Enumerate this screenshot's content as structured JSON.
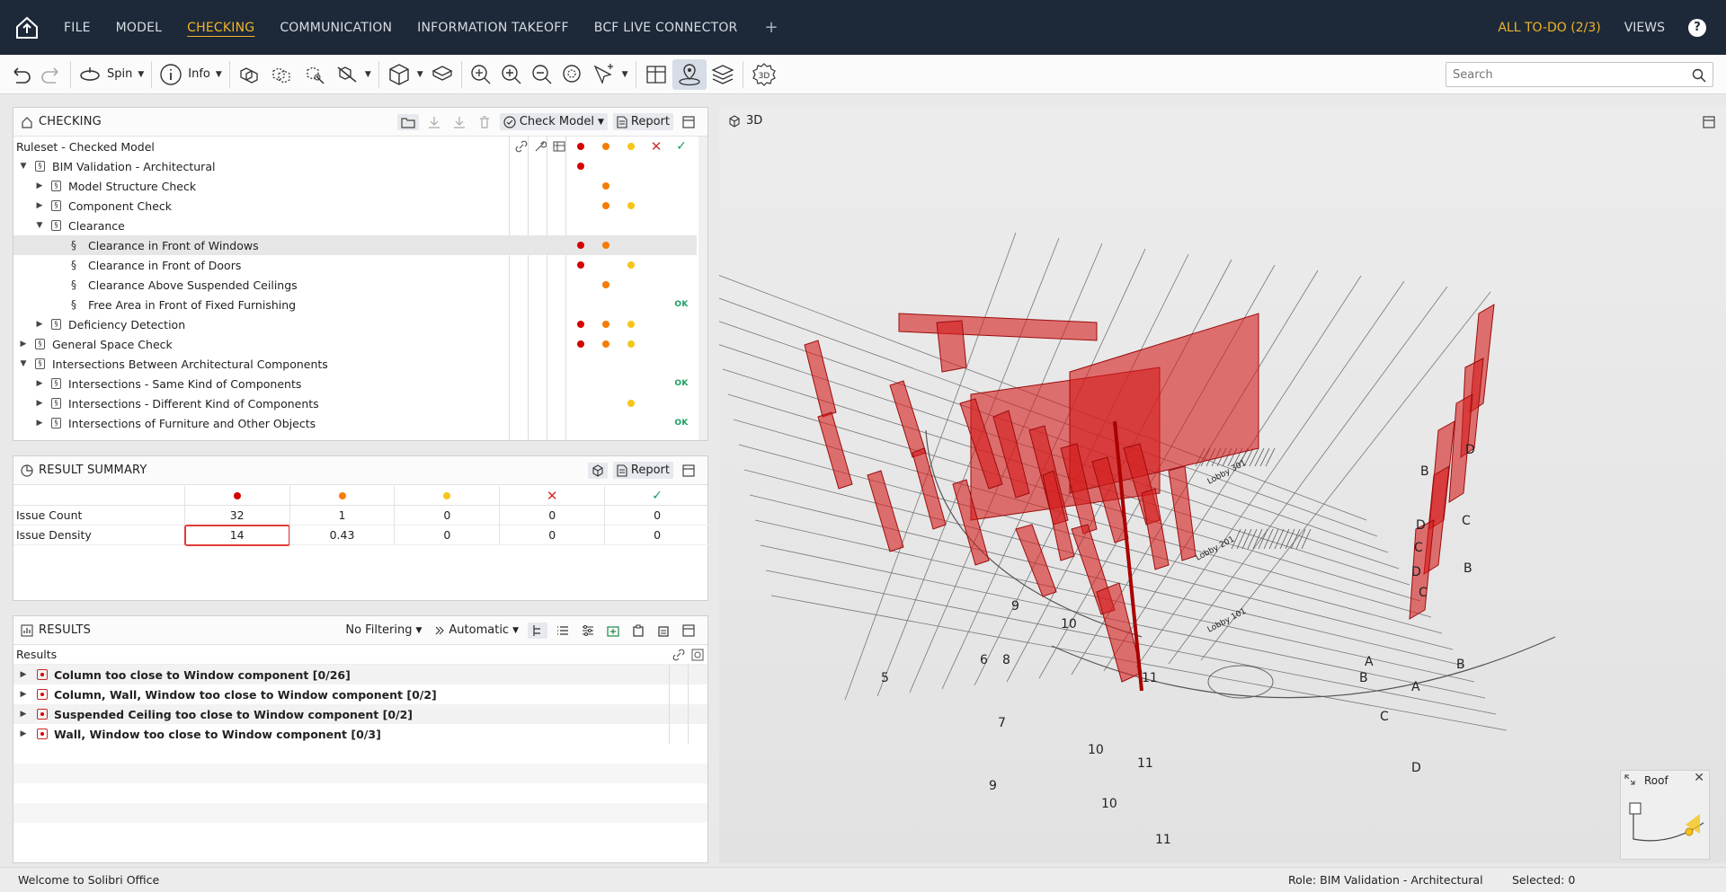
{
  "nav": {
    "menus": [
      "FILE",
      "MODEL",
      "CHECKING",
      "COMMUNICATION",
      "INFORMATION TAKEOFF",
      "BCF LIVE CONNECTOR"
    ],
    "plus": "+",
    "todo": "ALL TO-DO (2/3)",
    "views": "VIEWS",
    "help": "?"
  },
  "toolbar": {
    "spin": "Spin",
    "info": "Info",
    "three_d": "3D"
  },
  "search": {
    "placeholder": "Search"
  },
  "checking": {
    "title": "CHECKING",
    "check_model": "Check Model",
    "report": "Report",
    "ruleset_header": "Ruleset - Checked Model",
    "rows": [
      {
        "label": "BIM Validation - Architectural",
        "level": 0,
        "expander": "open",
        "icon": "ruleset",
        "red": true,
        "orange": false,
        "yellow": false,
        "ok": false
      },
      {
        "label": "Model Structure Check",
        "level": 1,
        "expander": "closed",
        "icon": "ruleset",
        "red": false,
        "orange": true,
        "yellow": false,
        "ok": false
      },
      {
        "label": "Component Check",
        "level": 1,
        "expander": "closed",
        "icon": "ruleset",
        "red": false,
        "orange": true,
        "yellow": true,
        "ok": false
      },
      {
        "label": "Clearance",
        "level": 1,
        "expander": "open",
        "icon": "ruleset",
        "red": false,
        "orange": false,
        "yellow": false,
        "ok": false
      },
      {
        "label": "Clearance in Front of Windows",
        "level": 2,
        "expander": "none",
        "icon": "rule",
        "red": true,
        "orange": true,
        "yellow": false,
        "ok": false,
        "selected": true
      },
      {
        "label": "Clearance in Front of Doors",
        "level": 2,
        "expander": "none",
        "icon": "rule",
        "red": true,
        "orange": false,
        "yellow": true,
        "ok": false
      },
      {
        "label": "Clearance Above Suspended Ceilings",
        "level": 2,
        "expander": "none",
        "icon": "rule",
        "red": false,
        "orange": true,
        "yellow": false,
        "ok": false
      },
      {
        "label": "Free Area in Front of Fixed Furnishing",
        "level": 2,
        "expander": "none",
        "icon": "rule",
        "red": false,
        "orange": false,
        "yellow": false,
        "ok": true
      },
      {
        "label": "Deficiency Detection",
        "level": 1,
        "expander": "closed",
        "icon": "ruleset",
        "red": true,
        "orange": true,
        "yellow": true,
        "ok": false
      },
      {
        "label": "General Space Check",
        "level": 0,
        "expander": "closed",
        "icon": "ruleset",
        "red": true,
        "orange": true,
        "yellow": true,
        "ok": false
      },
      {
        "label": "Intersections Between Architectural Components",
        "level": 0,
        "expander": "open",
        "icon": "ruleset",
        "red": false,
        "orange": false,
        "yellow": false,
        "ok": false
      },
      {
        "label": "Intersections - Same Kind of Components",
        "level": 1,
        "expander": "closed",
        "icon": "ruleset",
        "red": false,
        "orange": false,
        "yellow": false,
        "ok": true
      },
      {
        "label": "Intersections - Different Kind of Components",
        "level": 1,
        "expander": "closed",
        "icon": "ruleset",
        "red": false,
        "orange": false,
        "yellow": true,
        "ok": false
      },
      {
        "label": "Intersections of Furniture and Other Objects",
        "level": 1,
        "expander": "closed",
        "icon": "ruleset",
        "red": false,
        "orange": false,
        "yellow": false,
        "ok": true
      }
    ],
    "ok_text": "OK"
  },
  "summary": {
    "title": "RESULT SUMMARY",
    "report": "Report",
    "rows": [
      {
        "label": "Issue Count",
        "values": [
          "32",
          "1",
          "0",
          "0",
          "0"
        ]
      },
      {
        "label": "Issue Density",
        "values": [
          "14",
          "0.43",
          "0",
          "0",
          "0"
        ]
      }
    ]
  },
  "results": {
    "title": "RESULTS",
    "filter": "No Filtering",
    "mode": "Automatic",
    "header": "Results",
    "items": [
      "Column too close to Window component [0/26]",
      "Column, Wall, Window too close to Window component [0/2]",
      "Suspended Ceiling too close to Window component [0/2]",
      "Wall, Window too close to Window component [0/3]"
    ]
  },
  "view3d": {
    "title": "3D",
    "minimap_title": "Roof",
    "grid_labels": [
      "10",
      "11",
      "9",
      "8",
      "7",
      "6",
      "5",
      "10",
      "11",
      "9",
      "10",
      "11",
      "A",
      "B",
      "C",
      "A",
      "B",
      "C",
      "D",
      "B",
      "C",
      "D",
      "B",
      "C",
      "D",
      "D"
    ],
    "lobby_labels": [
      "Lobby 301",
      "Lobby 201",
      "Lobby 101"
    ]
  },
  "status": {
    "welcome": "Welcome to Solibri Office",
    "role": "Role: BIM Validation - Architectural",
    "selected": "Selected: 0"
  },
  "colors": {
    "nav_bg": "#1d2939",
    "accent": "#f0b429",
    "red": "#d50000",
    "orange": "#f57c00",
    "yellow": "#f5c518",
    "ok": "#18a05e"
  }
}
